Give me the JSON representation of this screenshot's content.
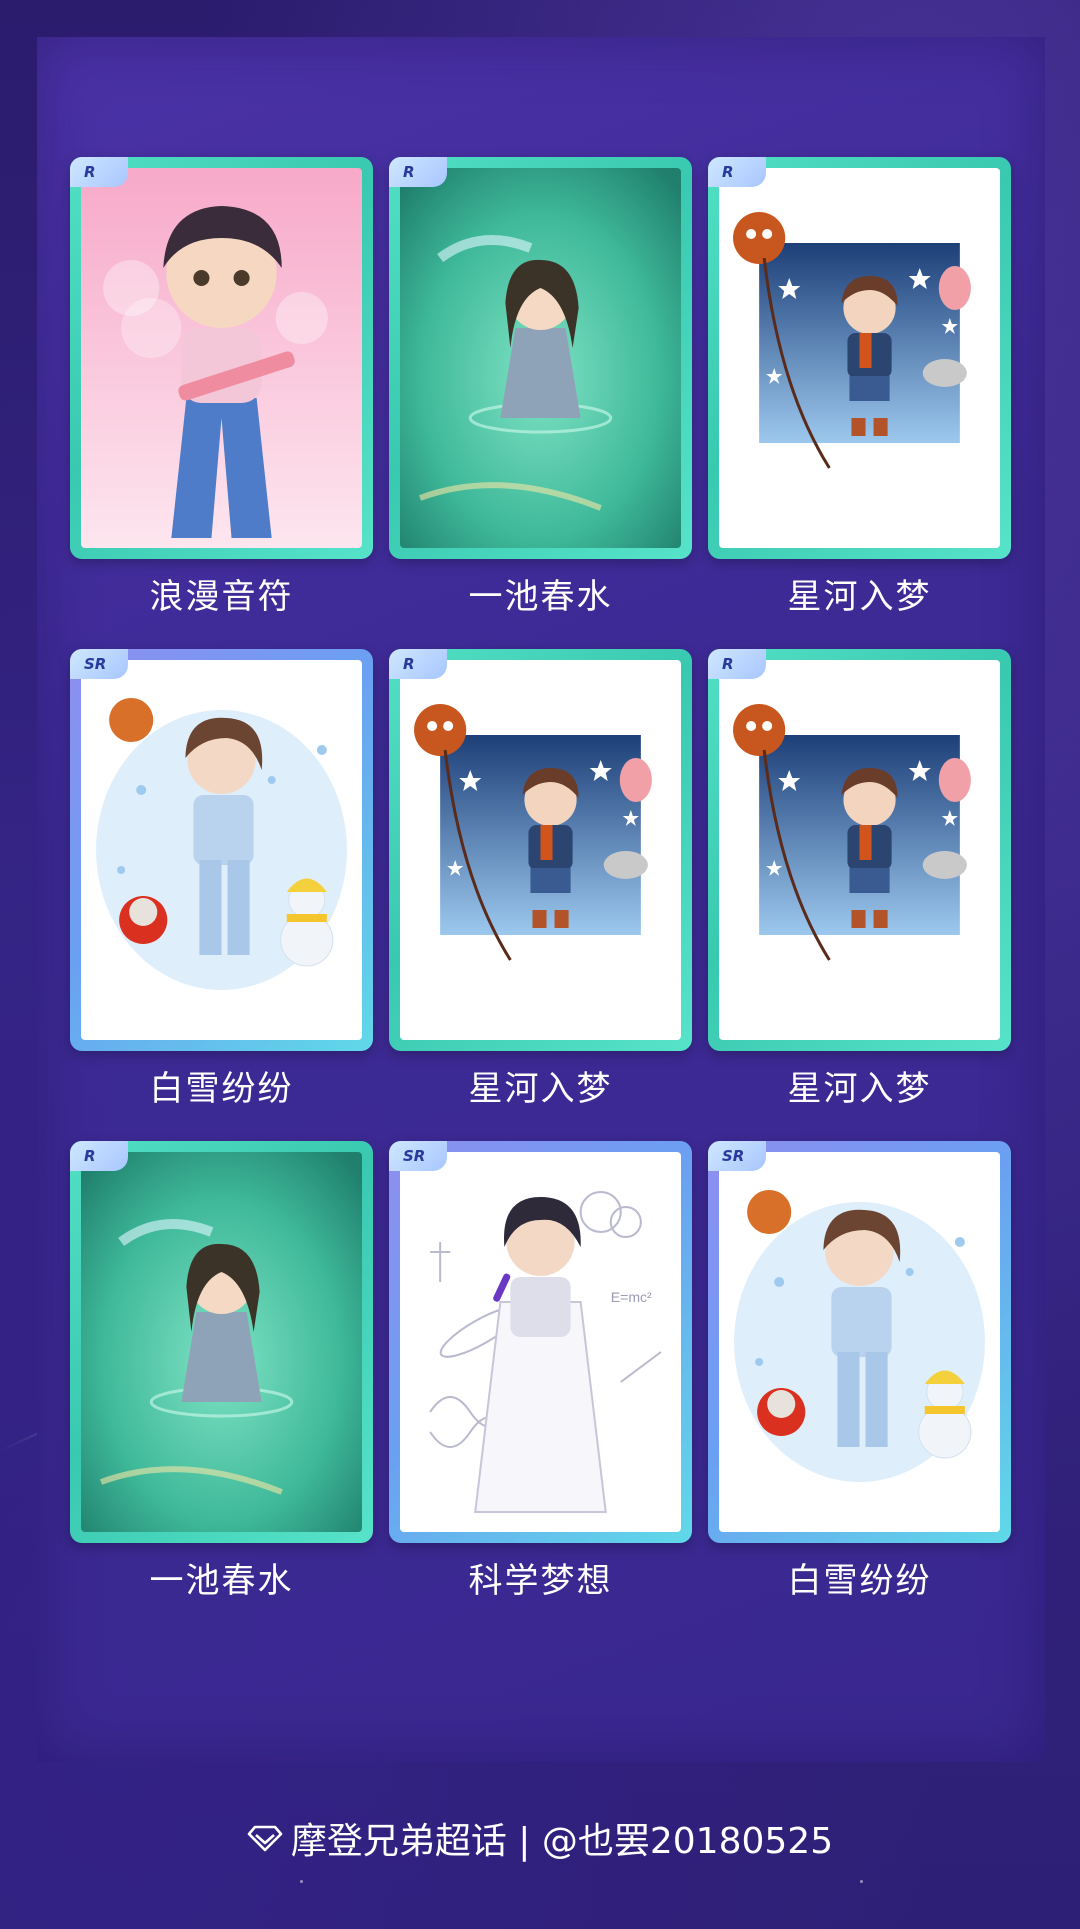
{
  "cards": [
    {
      "rarity": "R",
      "art": "pink",
      "label": "浪漫音符"
    },
    {
      "rarity": "R",
      "art": "water",
      "label": "一池春水"
    },
    {
      "rarity": "R",
      "art": "star",
      "label": "星河入梦"
    },
    {
      "rarity": "SR",
      "art": "snow",
      "label": "白雪纷纷"
    },
    {
      "rarity": "R",
      "art": "star",
      "label": "星河入梦"
    },
    {
      "rarity": "R",
      "art": "star",
      "label": "星河入梦"
    },
    {
      "rarity": "R",
      "art": "water",
      "label": "一池春水"
    },
    {
      "rarity": "SR",
      "art": "science",
      "label": "科学梦想"
    },
    {
      "rarity": "SR",
      "art": "snow",
      "label": "白雪纷纷"
    }
  ],
  "footer": {
    "icon": "diamond-icon",
    "text": "摩登兄弟超话 | @也罢20180525"
  },
  "colors": {
    "background": "#2e1f76",
    "panel": "#3d2a95",
    "card_frame_r": "#45d4bb",
    "card_frame_sr": "#6fa2f0"
  }
}
